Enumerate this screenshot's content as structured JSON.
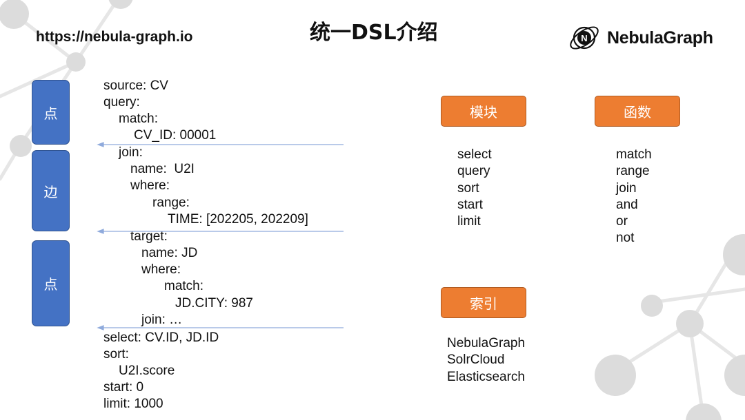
{
  "header": {
    "url": "https://nebula-graph.io",
    "title": "统一DSL介绍",
    "brand": "NebulaGraph"
  },
  "side_boxes": [
    "点",
    "边",
    "点"
  ],
  "code_lines": [
    "source: CV",
    "query:",
    "match:",
    "CV_ID: 00001",
    "join:",
    "name:  U2I",
    "where:",
    "range:",
    "TIME: [202205, 202209]",
    "target:",
    "name: JD",
    "where:",
    "match:",
    "JD.CITY: 987",
    "join: …",
    "select: CV.ID, JD.ID",
    "sort:",
    "U2I.score",
    "start: 0",
    "limit: 1000"
  ],
  "modules": {
    "label": "模块",
    "items": [
      "select",
      "query",
      "sort",
      "start",
      "limit"
    ]
  },
  "functions": {
    "label": "函数",
    "items": [
      "match",
      "range",
      "join",
      "and",
      "or",
      "not"
    ]
  },
  "index": {
    "label": "索引",
    "items": [
      "NebulaGraph",
      "SolrCloud",
      "Elasticsearch"
    ]
  },
  "colors": {
    "side_box": "#4472c4",
    "orange_box": "#ed7d31",
    "arrow": "#8faadc"
  }
}
